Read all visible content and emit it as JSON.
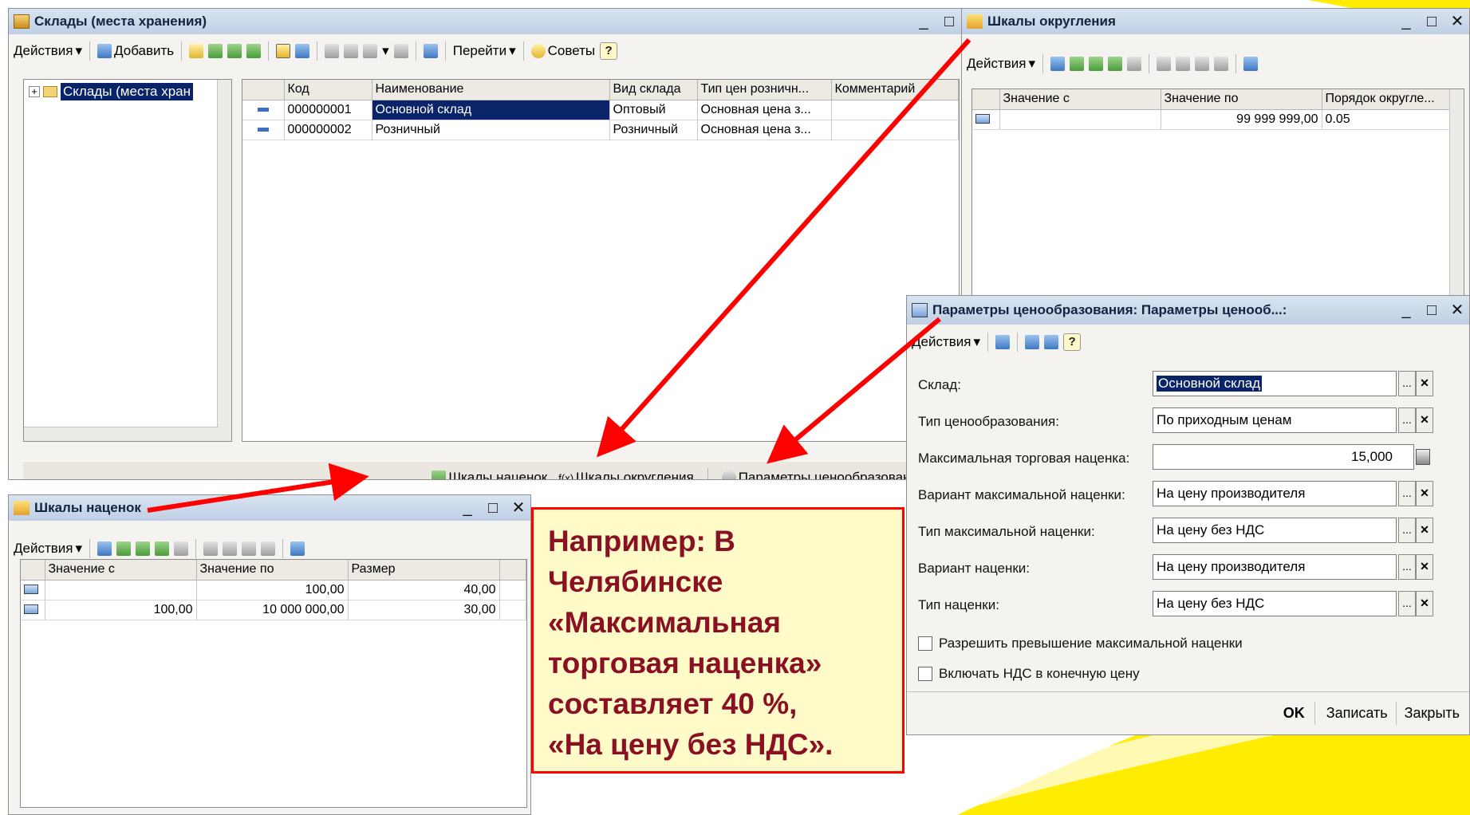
{
  "warehouses": {
    "title": "Склады (места хранения)",
    "toolbar": {
      "actions": "Действия",
      "add": "Добавить",
      "goto": "Перейти",
      "tips": "Советы",
      "help": "?"
    },
    "tree_item": "Склады (места хран",
    "columns": [
      "Код",
      "Наименование",
      "Вид склада",
      "Тип цен розничн...",
      "Комментарий"
    ],
    "rows": [
      {
        "code": "000000001",
        "name": "Основной склад",
        "kind": "Оптовый",
        "price_type": "Основная цена з...",
        "comment": ""
      },
      {
        "code": "000000002",
        "name": "Розничный",
        "kind": "Розничный",
        "price_type": "Основная цена з...",
        "comment": ""
      }
    ],
    "bottom_links": {
      "markups": "Шкалы наценок",
      "rounding": "Шкалы округления",
      "pricing": "Параметры ценообразования"
    }
  },
  "rounding": {
    "title": "Шкалы округления",
    "toolbar": {
      "actions": "Действия"
    },
    "columns": [
      "Значение с",
      "Значение по",
      "Порядок округле..."
    ],
    "rows": [
      {
        "from": "",
        "to": "99 999 999,00",
        "order": "0.05"
      }
    ]
  },
  "pricing": {
    "title": "Параметры ценообразования: Параметры ценооб...:",
    "toolbar": {
      "actions": "Действия",
      "help": "?"
    },
    "fields": [
      {
        "label": "Склад:",
        "value": "Основной склад"
      },
      {
        "label": "Тип ценообразования:",
        "value": "По приходным ценам"
      },
      {
        "label": "Максимальная торговая наценка:",
        "value": "15,000"
      },
      {
        "label": "Вариант максимальной наценки:",
        "value": "На цену производителя"
      },
      {
        "label": "Тип максимальной наценки:",
        "value": "На цену без НДС"
      },
      {
        "label": "Вариант наценки:",
        "value": "На цену производителя"
      },
      {
        "label": "Тип наценки:",
        "value": "На цену без НДС"
      }
    ],
    "checkboxes": [
      "Разрешить превышение максимальной наценки",
      "Включать НДС в конечную цену"
    ],
    "buttons": {
      "ok": "OK",
      "save": "Записать",
      "close": "Закрыть"
    }
  },
  "markups": {
    "title": "Шкалы наценок",
    "toolbar": {
      "actions": "Действия"
    },
    "columns": [
      "Значение с",
      "Значение по",
      "Размер"
    ],
    "rows": [
      {
        "from": "",
        "to": "100,00",
        "size": "40,00"
      },
      {
        "from": "100,00",
        "to": "10 000 000,00",
        "size": "30,00"
      }
    ]
  },
  "callout": {
    "text": "Например: В\nЧелябинске\n«Максимальная\nторговая наценка»\nсоставляет 40 %,\n«На цену без НДС»."
  },
  "colors": {
    "accent_red": "#ff0000",
    "callout_text": "#8a1024",
    "selection": "#0a246a",
    "background_yellow": "#ffec00"
  }
}
